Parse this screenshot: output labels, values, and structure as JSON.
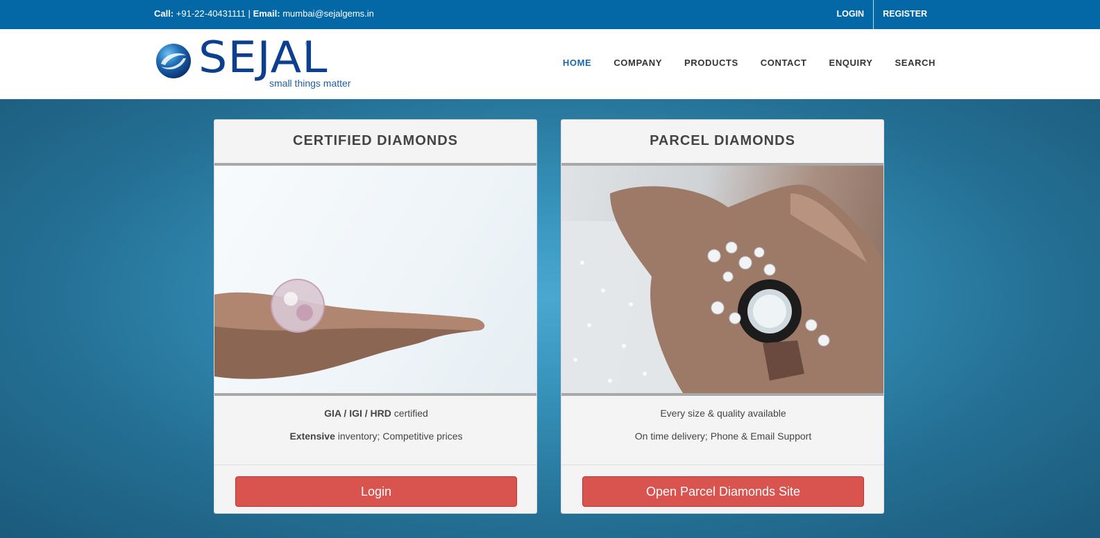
{
  "topbar": {
    "call_label": "Call:",
    "phone": "+91-22-40431111",
    "separator": "|",
    "email_label": "Email:",
    "email": "mumbai@sejalgems.in",
    "login": "LOGIN",
    "register": "REGISTER"
  },
  "brand": {
    "name": "SEJAL",
    "registered": "®",
    "tagline": "small things matter"
  },
  "nav": {
    "items": [
      "HOME",
      "COMPANY",
      "PRODUCTS",
      "CONTACT",
      "ENQUIRY",
      "SEARCH"
    ],
    "active": "HOME"
  },
  "cards": [
    {
      "title": "CERTIFIED DIAMONDS",
      "line1_bold": "GIA / IGI / HRD",
      "line1_rest": " certified",
      "line2_bold": "Extensive",
      "line2_rest": " inventory; Competitive prices",
      "button": "Login"
    },
    {
      "title": "PARCEL DIAMONDS",
      "line1": "Every size & quality available",
      "line2": "On time delivery; Phone & Email Support",
      "button": "Open Parcel Diamonds Site"
    }
  ],
  "colors": {
    "topbar": "#0568a6",
    "nav_active": "#1b67a8",
    "button": "#d9534f",
    "hero": "#2a7aa0"
  }
}
